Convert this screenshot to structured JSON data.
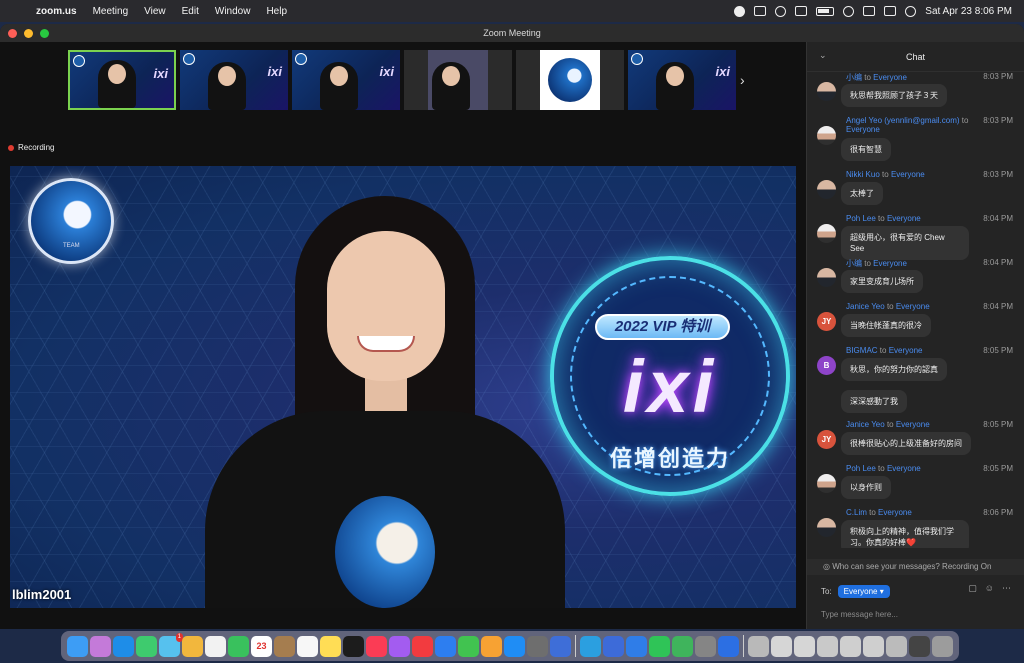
{
  "menubar": {
    "app_name": "zoom.us",
    "menus": [
      "Meeting",
      "View",
      "Edit",
      "Window",
      "Help"
    ],
    "datetime": "Sat Apr 23  8:06 PM"
  },
  "window": {
    "title": "Zoom Meeting"
  },
  "status": {
    "recording_label": "Recording"
  },
  "thumbnails": [
    {
      "label": "ixi",
      "active": true
    },
    {
      "label": "ixi",
      "active": false
    },
    {
      "label": "ixi",
      "active": false
    },
    {
      "label": "",
      "active": false
    },
    {
      "label": "",
      "active": false
    },
    {
      "label": "ixi",
      "active": false
    }
  ],
  "video": {
    "logo_text": "TEAM",
    "vip_banner": "2022 VIP 特训",
    "brand": "ixi",
    "slogan": "倍增创造力",
    "participant_name": "lblim2001"
  },
  "chat": {
    "title": "Chat",
    "messages": [
      {
        "sender": "小编",
        "to": "to",
        "target": "Everyone",
        "time": "8:03 PM",
        "text": "秋思帮我照顾了孩子３天",
        "avatar": "photo"
      },
      {
        "sender": "Angel Yeo (yennlin@gmail.com)",
        "to": "to",
        "target": "Everyone",
        "time": "8:03 PM",
        "text": "很有智慧",
        "avatar": "photo"
      },
      {
        "sender": "Nikki Kuo",
        "to": "to",
        "target": "Everyone",
        "time": "8:03 PM",
        "text": "太棒了",
        "avatar": "photo"
      },
      {
        "sender": "Poh Lee",
        "to": "to",
        "target": "Everyone",
        "time": "8:04 PM",
        "text": "超级用心，很有爱的 Chew See",
        "avatar": "photo"
      },
      {
        "sender": "小编",
        "to": "to",
        "target": "Everyone",
        "time": "8:04 PM",
        "text": "家里变成育儿场所",
        "avatar": "photo"
      },
      {
        "sender": "Janice Yeo",
        "to": "to",
        "target": "Everyone",
        "time": "8:04 PM",
        "text": "当晚住帐蓬真的很冷",
        "avatar": "JY",
        "avatar_color": "#d8533c"
      },
      {
        "sender": "BIGMAC",
        "to": "to",
        "target": "Everyone",
        "time": "8:05 PM",
        "text": "秋思，你的努力你的認真",
        "avatar": "B",
        "avatar_color": "#8e44c9"
      },
      {
        "sender": "",
        "to": "",
        "target": "",
        "time": "",
        "text": "深深感動了我",
        "avatar": ""
      },
      {
        "sender": "Janice Yeo",
        "to": "to",
        "target": "Everyone",
        "time": "8:05 PM",
        "text": "很棒很贴心的上级准备好的房间",
        "avatar": "JY",
        "avatar_color": "#d8533c"
      },
      {
        "sender": "Poh Lee",
        "to": "to",
        "target": "Everyone",
        "time": "8:05 PM",
        "text": "以身作则",
        "avatar": "photo"
      },
      {
        "sender": "C.Lim",
        "to": "to",
        "target": "Everyone",
        "time": "8:06 PM",
        "text": "积极向上的精神，值得我们学习。你真的好棒❤️",
        "avatar": "photo"
      }
    ],
    "notice": "Who can see your messages? Recording On",
    "to_label": "To:",
    "to_value": "Everyone",
    "input_placeholder": "Type message here..."
  },
  "dock": {
    "calendar_date": "23",
    "mail_badge": "1"
  },
  "colors": {
    "accent": "#1f6fe0",
    "active_thumb": "#7bd24f",
    "recording": "#e03c31",
    "name_link": "#4a8cf0"
  }
}
